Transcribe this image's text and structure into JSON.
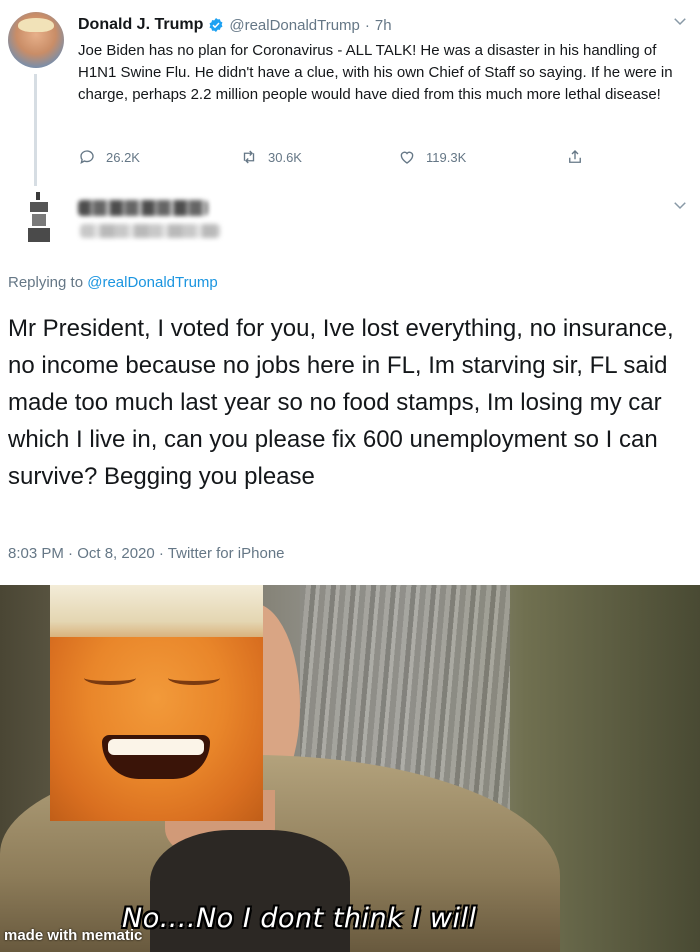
{
  "tweet": {
    "author_name": "Donald J. Trump",
    "handle": "@realDonaldTrump",
    "separator": "·",
    "time": "7h",
    "text": "Joe Biden has no plan for Coronavirus - ALL TALK! He was a disaster in his handling of H1N1 Swine Flu. He didn't have a clue, with his own Chief of Staff so saying. If he were in charge, perhaps 2.2 million people would have died from this much more lethal disease!",
    "replies": "26.2K",
    "retweets": "30.6K",
    "likes": "119.3K"
  },
  "reply": {
    "replying_prefix": "Replying to",
    "replying_to": "@realDonaldTrump",
    "text": "Mr President, I voted for you, Ive lost everything, no insurance, no income because no jobs here in FL, Im starving sir, FL said made too much last year so no food stamps, Im losing my car which I live in, can you please fix 600 unemployment so I can survive? Begging you please",
    "timestamp": "8:03 PM · Oct 8, 2020 · Twitter for iPhone"
  },
  "meme": {
    "caption": "No....No I dont think I will",
    "watermark": "made with mematic"
  },
  "icons": {
    "verified": "verified-badge-icon",
    "menu": "chevron-down-icon",
    "reply": "reply-bubble-icon",
    "retweet": "retweet-icon",
    "like": "heart-icon",
    "share": "share-icon"
  },
  "colors": {
    "brand_blue": "#1da1f2",
    "link_blue": "#1b95e0",
    "text": "#14171a",
    "muted": "#657786"
  }
}
